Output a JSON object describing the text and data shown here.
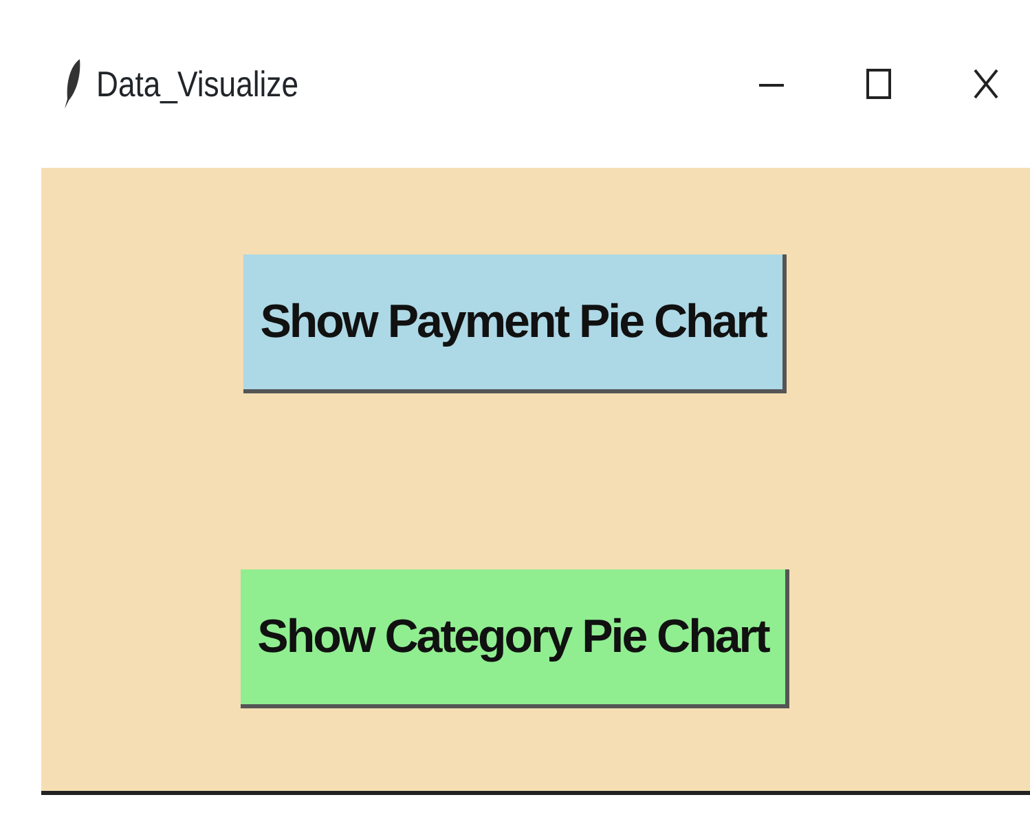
{
  "window": {
    "title": "Data_Visualize"
  },
  "buttons": [
    {
      "label": "Show Payment Pie Chart",
      "color": "#add8e6"
    },
    {
      "label": "Show Category Pie Chart",
      "color": "#90ee90"
    }
  ]
}
